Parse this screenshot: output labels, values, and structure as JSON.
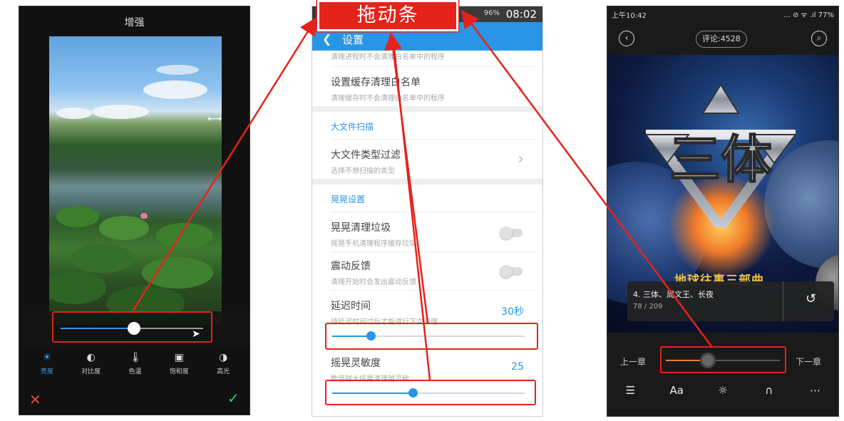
{
  "callout": {
    "label": "拖动条"
  },
  "enhance": {
    "title": "增强",
    "tools": [
      {
        "icon": "sun-icon",
        "label": "亮度",
        "active": true
      },
      {
        "icon": "contrast-icon",
        "label": "对比度"
      },
      {
        "icon": "thermometer-icon",
        "label": "色温"
      },
      {
        "icon": "saturation-icon",
        "label": "饱和度"
      },
      {
        "icon": "highlight-icon",
        "label": "高光"
      }
    ],
    "slider_value": 0.52
  },
  "settings": {
    "status_time": "08:02",
    "battery": "96%",
    "title": "设置",
    "top_hint": "清理进程时不会清理白名单中的程序",
    "rows": {
      "whitelist_title": "设置缓存清理白名单",
      "whitelist_sub": "清理缓存时不会清理白名单中的程序",
      "section_large": "大文件扫描",
      "filetype_title": "大文件类型过滤",
      "filetype_sub": "选择不想扫描的类型",
      "section_shake": "晃晃设置",
      "shake_title": "晃晃清理垃圾",
      "shake_sub": "摇晃手机清理程序缓存垃圾",
      "vibrate_title": "震动反馈",
      "vibrate_sub": "清理开始时会发出震动反馈",
      "delay_title": "延迟时间",
      "delay_sub": "待延迟时间过后才能进行下次清理",
      "delay_value": "30秒",
      "sense_title": "摇晃灵敏度",
      "sense_sub": "数值越大摇晃清理越灵敏",
      "sense_value": "25"
    },
    "delay_slider": 0.2,
    "sense_slider": 0.42
  },
  "reader": {
    "status_time": "上午10:42",
    "status_right": "... ⊘ ᯤ .ıl 77%",
    "comments": "评论:4528",
    "logo_text": "三体",
    "cover_subtitle": "地球往事三部曲",
    "chapter_title": "4. 三体、周文王、长夜",
    "chapter_pos": "78 / 209",
    "prev_label": "上一章",
    "next_label": "下一章",
    "progress": 0.37,
    "bottom_icons": [
      "list-icon",
      "font-size-icon",
      "brightness-icon",
      "headphones-icon",
      "more-icon"
    ],
    "font_label": "Aa"
  },
  "colors": {
    "accent_red": "#e5231b",
    "blue": "#2a95e6",
    "orange": "#f07a2a"
  }
}
